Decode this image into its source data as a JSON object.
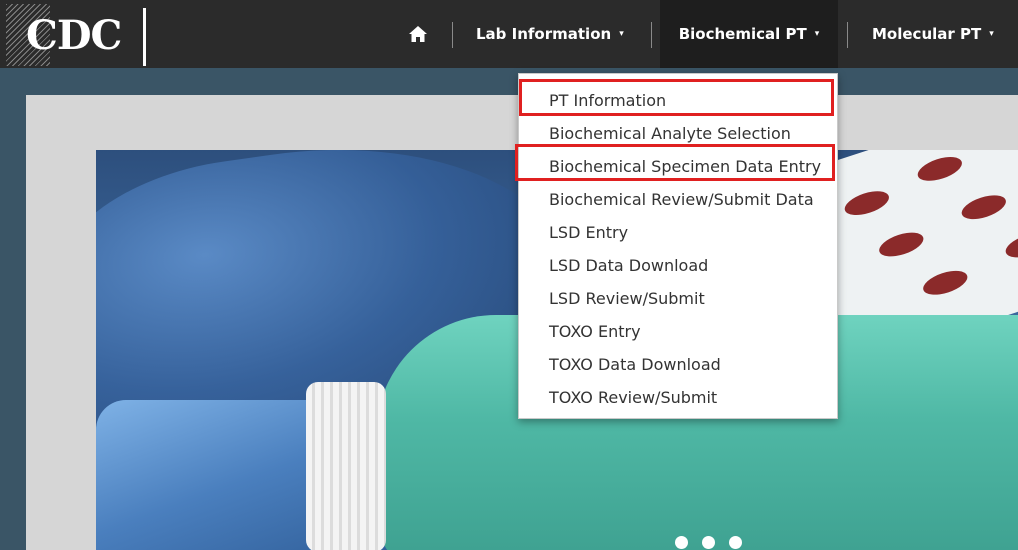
{
  "logo": {
    "text": "CDC"
  },
  "nav": {
    "home_icon": "home-icon",
    "items": [
      {
        "label": "Lab Information"
      },
      {
        "label": "Biochemical PT"
      },
      {
        "label": "Molecular PT"
      }
    ],
    "caret": "▾"
  },
  "dropdown": {
    "items": [
      {
        "label": "PT Information",
        "highlighted": true
      },
      {
        "label": "Biochemical Analyte Selection"
      },
      {
        "label": "Biochemical Specimen Data Entry",
        "highlighted": true
      },
      {
        "label": "Biochemical Review/Submit Data"
      },
      {
        "label": "LSD Entry"
      },
      {
        "label": "LSD Data Download"
      },
      {
        "label": "LSD Review/Submit"
      },
      {
        "label": "TOXO Entry"
      },
      {
        "label": "TOXO Data Download"
      },
      {
        "label": "TOXO Review/Submit"
      }
    ]
  },
  "carousel": {
    "dot_count": 3
  },
  "colors": {
    "navbar": "#2b2b2b",
    "highlight": "#e02020",
    "page_background": "#3a5566"
  }
}
